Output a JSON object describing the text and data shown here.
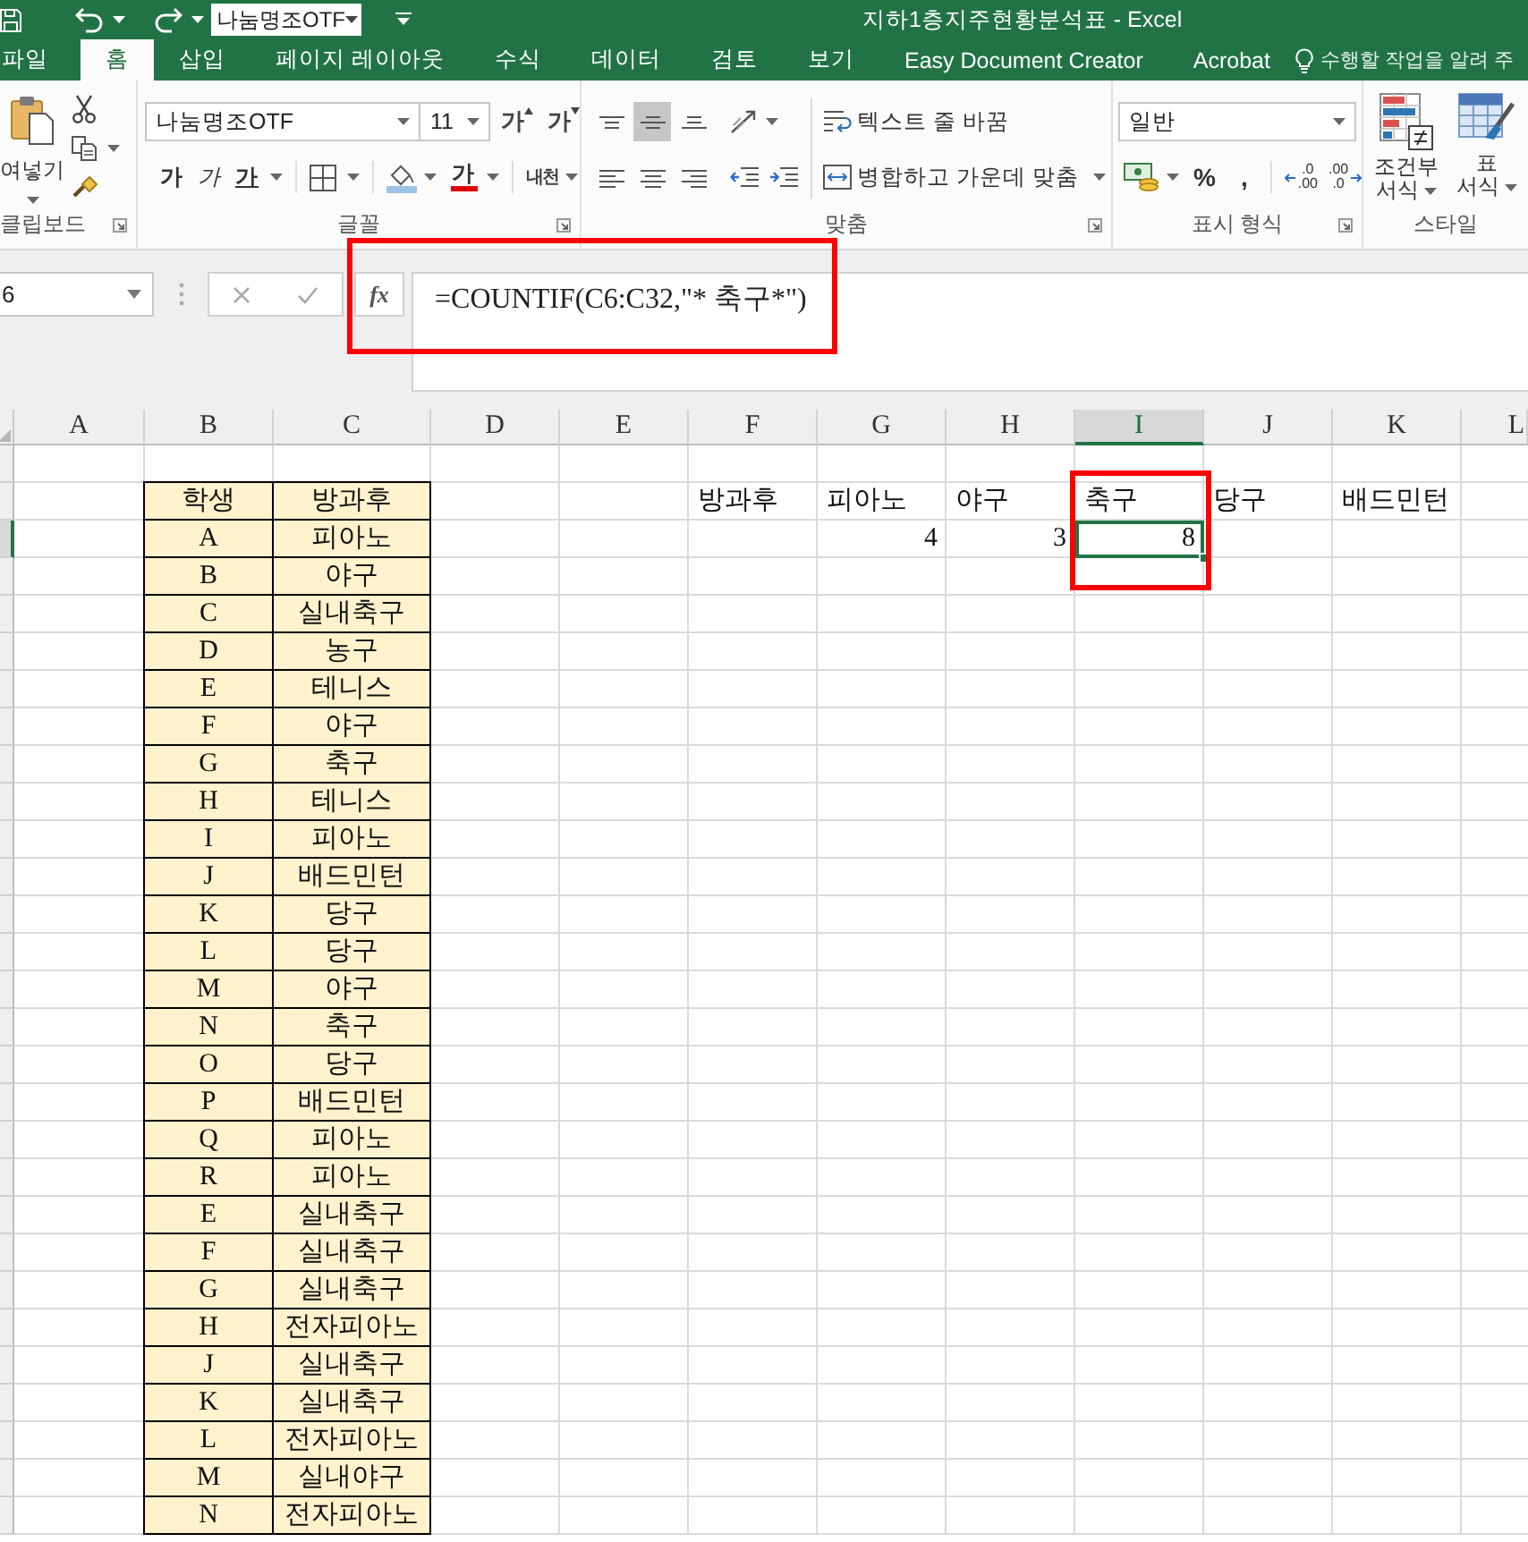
{
  "title_bar": {
    "font_combo": "나눔명조OTF",
    "title": "지하1층지주현황분석표 - Excel"
  },
  "tabs": [
    {
      "label": "파일",
      "selected": false
    },
    {
      "label": "홈",
      "selected": true
    },
    {
      "label": "삽입",
      "selected": false
    },
    {
      "label": "페이지 레이아웃",
      "selected": false
    },
    {
      "label": "수식",
      "selected": false
    },
    {
      "label": "데이터",
      "selected": false
    },
    {
      "label": "검토",
      "selected": false
    },
    {
      "label": "보기",
      "selected": false
    },
    {
      "label": "Easy Document Creator",
      "selected": false
    },
    {
      "label": "Acrobat",
      "selected": false
    }
  ],
  "tell_me": {
    "placeholder": "수행할 작업을 알려 주"
  },
  "ribbon": {
    "clipboard": {
      "paste_label": "여넣기",
      "group_label": "클립보드"
    },
    "font": {
      "font_name": "나눔명조OTF",
      "font_size": "11",
      "grow_glyph": "가",
      "shrink_glyph": "가",
      "bold_glyph": "가",
      "italic_glyph": "가",
      "underline_glyph": "가",
      "font_color_glyph": "가",
      "phonetic_glyph": "내천",
      "group_label": "글꼴"
    },
    "alignment": {
      "vertical": [
        {
          "kind": "top",
          "selected": false
        },
        {
          "kind": "middle",
          "selected": true
        },
        {
          "kind": "bottom",
          "selected": false
        }
      ],
      "horizontal": [
        {
          "kind": "left",
          "selected": false
        },
        {
          "kind": "center",
          "selected": false
        },
        {
          "kind": "right",
          "selected": false
        }
      ],
      "wrap_text": "텍스트 줄 바꿈",
      "merge_center": "병합하고 가운데 맞춤",
      "group_label": "맞춤"
    },
    "number": {
      "format": "일반",
      "percent": "%",
      "comma": ",",
      "increase_decimal": [
        ".0",
        ".00"
      ],
      "decrease_decimal": [
        ".00",
        ".0"
      ],
      "group_label": "표시 형식"
    },
    "styles": {
      "conditional_format": [
        "조건부",
        "서식"
      ],
      "format_table": [
        "표",
        "서식"
      ],
      "group_label": "스타일"
    }
  },
  "formula_bar": {
    "name_box": "6",
    "fx": "fx",
    "formula": "=COUNTIF(C6:C32,\"* 축구*\")"
  },
  "sheet": {
    "columns": [
      {
        "label": "A",
        "selected": false
      },
      {
        "label": "B",
        "selected": false
      },
      {
        "label": "C",
        "selected": false
      },
      {
        "label": "D",
        "selected": false
      },
      {
        "label": "E",
        "selected": false
      },
      {
        "label": "F",
        "selected": false
      },
      {
        "label": "G",
        "selected": false
      },
      {
        "label": "H",
        "selected": false
      },
      {
        "label": "I",
        "selected": true
      },
      {
        "label": "J",
        "selected": false
      },
      {
        "label": "K",
        "selected": false
      },
      {
        "label": "L",
        "selected": false
      }
    ],
    "row_headers": [
      {
        "selected": false
      },
      {
        "selected": false
      },
      {
        "selected": true
      },
      {
        "selected": false
      },
      {
        "selected": false
      },
      {
        "selected": false
      },
      {
        "selected": false
      },
      {
        "selected": false
      },
      {
        "selected": false
      },
      {
        "selected": false
      },
      {
        "selected": false
      },
      {
        "selected": false
      },
      {
        "selected": false
      },
      {
        "selected": false
      },
      {
        "selected": false
      },
      {
        "selected": false
      },
      {
        "selected": false
      },
      {
        "selected": false
      },
      {
        "selected": false
      },
      {
        "selected": false
      },
      {
        "selected": false
      },
      {
        "selected": false
      },
      {
        "selected": false
      },
      {
        "selected": false
      },
      {
        "selected": false
      },
      {
        "selected": false
      },
      {
        "selected": false
      },
      {
        "selected": false
      },
      {
        "selected": false
      }
    ],
    "student_table": {
      "columns": [
        "학생",
        "방과후"
      ],
      "rows": [
        [
          "A",
          "피아노"
        ],
        [
          "B",
          "야구"
        ],
        [
          "C",
          "실내축구"
        ],
        [
          "D",
          "농구"
        ],
        [
          "E",
          "테니스"
        ],
        [
          "F",
          "야구"
        ],
        [
          "G",
          "축구"
        ],
        [
          "H",
          "테니스"
        ],
        [
          "I",
          "피아노"
        ],
        [
          "J",
          "배드민턴"
        ],
        [
          "K",
          "당구"
        ],
        [
          "L",
          "당구"
        ],
        [
          "M",
          "야구"
        ],
        [
          "N",
          "축구"
        ],
        [
          "O",
          "당구"
        ],
        [
          "P",
          "배드민턴"
        ],
        [
          "Q",
          "피아노"
        ],
        [
          "R",
          "피아노"
        ],
        [
          "E",
          "실내축구"
        ],
        [
          "F",
          "실내축구"
        ],
        [
          "G",
          "실내축구"
        ],
        [
          "H",
          "전자피아노"
        ],
        [
          "J",
          "실내축구"
        ],
        [
          "K",
          "실내축구"
        ],
        [
          "L",
          "전자피아노"
        ],
        [
          "M",
          "실내야구"
        ],
        [
          "N",
          "전자피아노"
        ]
      ]
    },
    "summary": {
      "label": "방과후",
      "categories": [
        {
          "name": "피아노",
          "count": "4",
          "selected": false
        },
        {
          "name": "야구",
          "count": "3",
          "selected": false
        },
        {
          "name": "축구",
          "count": "8",
          "selected": true
        },
        {
          "name": "당구",
          "selected": false
        },
        {
          "name": "배드민턴",
          "selected": false
        }
      ]
    }
  }
}
